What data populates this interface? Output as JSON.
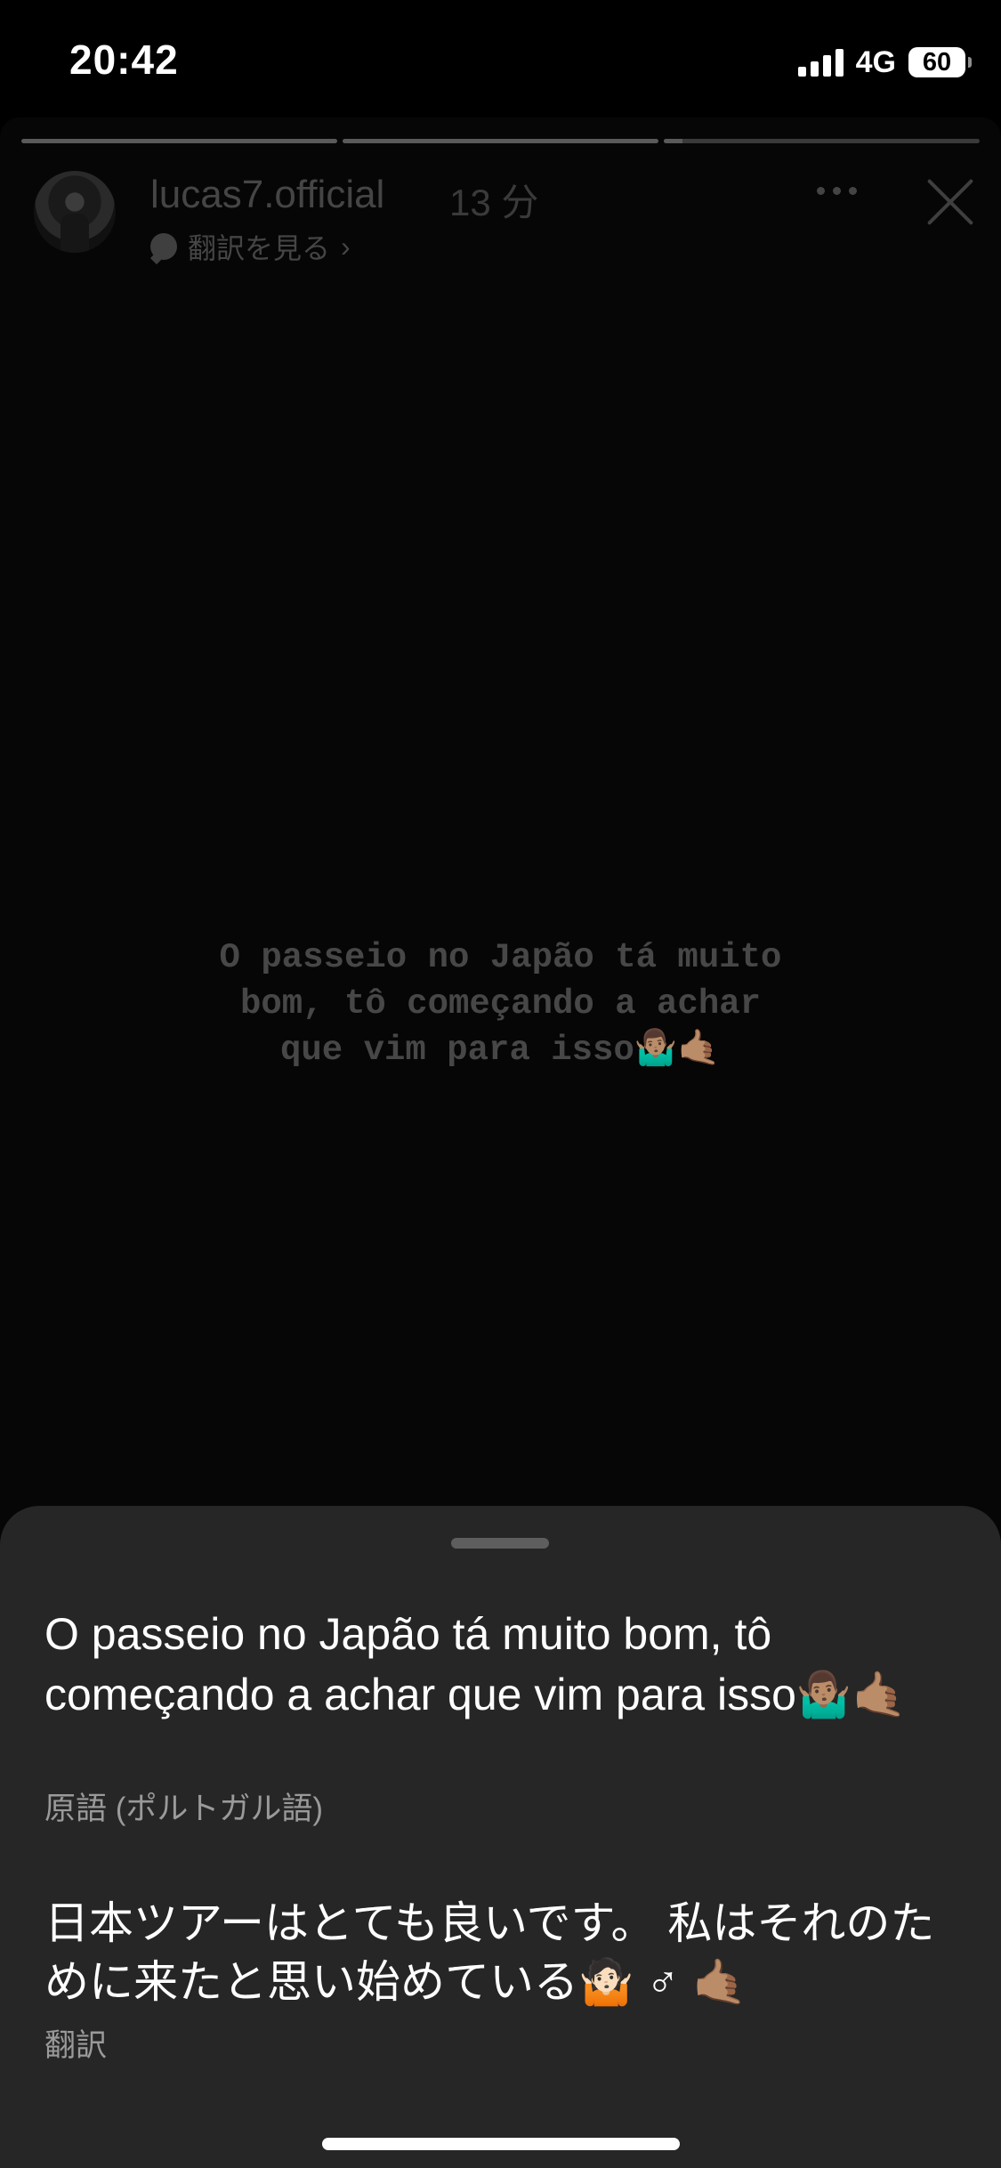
{
  "status_bar": {
    "time": "20:42",
    "network": "4G",
    "battery": "60"
  },
  "story": {
    "progress": [
      1.0,
      1.0,
      0.06
    ],
    "username": "lucas7.official",
    "time_ago": "13 分",
    "see_translation": "翻訳を見る",
    "text_line1": "O passeio no Japão tá muito",
    "text_line2": "bom, tô começando a achar",
    "text_line3": "que vim para isso🤷🏽‍♂️🤙🏽",
    "icons": {
      "more": "more-icon",
      "close": "close-icon"
    }
  },
  "translation_sheet": {
    "original_text": "O passeio no Japão tá muito bom, tô começando a achar que vim para isso🤷🏽‍♂️🤙🏽",
    "original_language": "原語 (ポルトガル語)",
    "translated_text": "日本ツアーはとても良いです。 私はそれのために来たと思い始めている🤷🏻 ♂ 🤙🏽",
    "translated_label": "翻訳"
  }
}
